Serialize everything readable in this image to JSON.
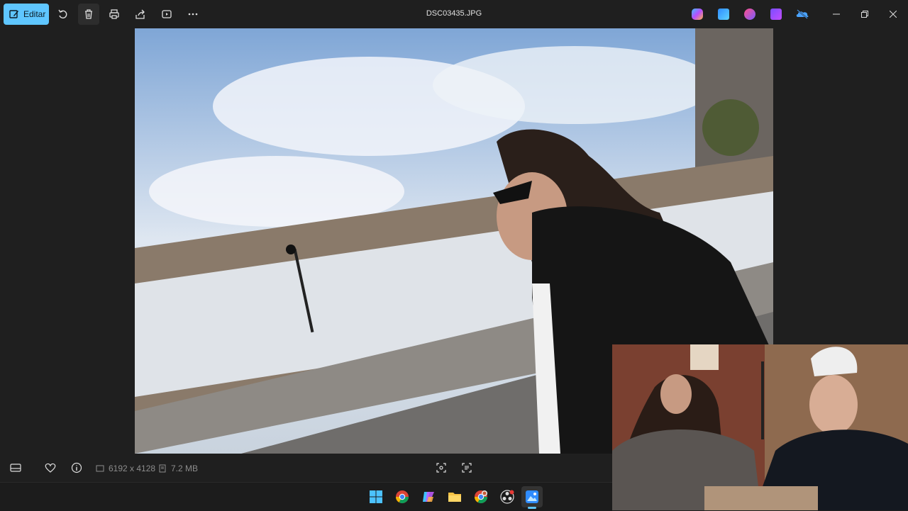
{
  "toolbar": {
    "edit_label": "Editar",
    "file_title": "DSC03435.JPG"
  },
  "info": {
    "dimensions": "6192 x 4128",
    "size": "7.2 MB"
  },
  "colors": {
    "accent": "#5fc6ff",
    "background": "#1f1f1f"
  },
  "icons": {
    "toolbar": [
      "edit-icon",
      "rotate-icon",
      "trash-icon",
      "print-icon",
      "share-icon",
      "slideshow-icon",
      "more-icon"
    ],
    "apps": [
      "copilot-icon",
      "photos-icon",
      "designer-icon",
      "clipchamp-icon",
      "onedrive-icon"
    ],
    "window": [
      "minimize-icon",
      "restore-icon",
      "close-icon"
    ],
    "bottom": [
      "filmstrip-icon",
      "favorite-icon",
      "info-icon",
      "fit-icon",
      "ocr-icon"
    ],
    "taskbar": [
      "windows-start-icon",
      "chrome-icon",
      "copilot-icon",
      "file-explorer-icon",
      "chrome-profile-icon",
      "obs-icon",
      "photos-icon"
    ]
  }
}
